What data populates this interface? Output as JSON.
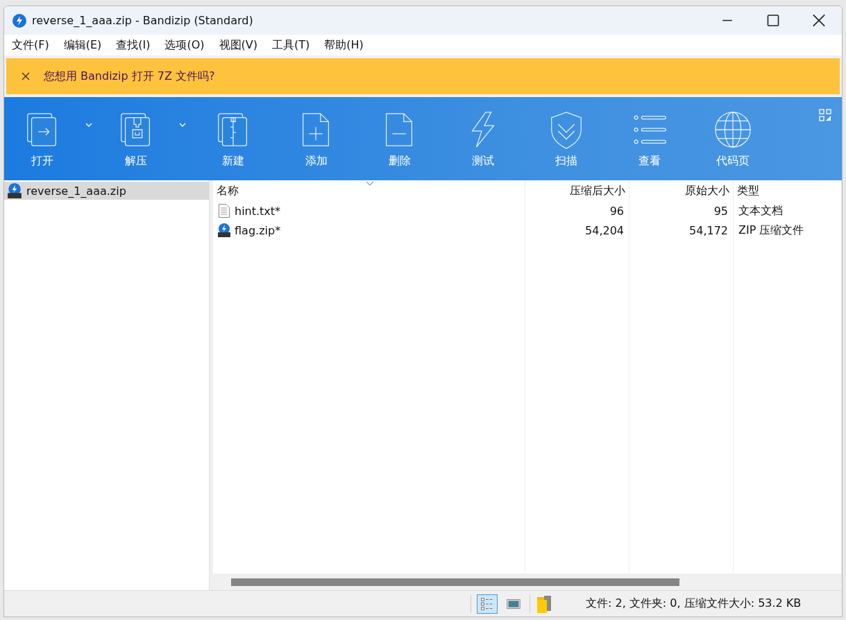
{
  "window": {
    "title": "reverse_1_aaa.zip - Bandizip (Standard)"
  },
  "menu": [
    "文件(F)",
    "编辑(E)",
    "查找(I)",
    "选项(O)",
    "视图(V)",
    "工具(T)",
    "帮助(H)"
  ],
  "banner": {
    "text": "您想用 Bandizip 打开 7Z 文件吗?"
  },
  "toolbar": [
    {
      "label": "打开",
      "kind": "open",
      "dropdown": true
    },
    {
      "label": "解压",
      "kind": "extract",
      "dropdown": true
    },
    {
      "label": "新建",
      "kind": "new",
      "dropdown": false
    },
    {
      "label": "添加",
      "kind": "add",
      "dropdown": false
    },
    {
      "label": "删除",
      "kind": "delete",
      "dropdown": false
    },
    {
      "label": "测试",
      "kind": "test",
      "dropdown": false
    },
    {
      "label": "扫描",
      "kind": "scan",
      "dropdown": false
    },
    {
      "label": "查看",
      "kind": "view",
      "dropdown": false
    },
    {
      "label": "代码页",
      "kind": "codepage",
      "dropdown": false
    }
  ],
  "tree": {
    "items": [
      {
        "label": "reverse_1_aaa.zip",
        "selected": true
      }
    ]
  },
  "table": {
    "columns": [
      "名称",
      "压缩后大小",
      "原始大小",
      "类型"
    ],
    "rows": [
      {
        "kind": "text",
        "name": "hint.txt*",
        "packed": "96",
        "size": "95",
        "type": "文本文档"
      },
      {
        "kind": "zip",
        "name": "flag.zip*",
        "packed": "54,204",
        "size": "54,172",
        "type": "ZIP 压缩文件"
      }
    ]
  },
  "status_bar": {
    "views": [
      {
        "kind": "details",
        "selected": true
      },
      {
        "kind": "thumbnails",
        "selected": false
      }
    ],
    "text": "文件: 2, 文件夹: 0, 压缩文件大小: 53.2 KB"
  }
}
